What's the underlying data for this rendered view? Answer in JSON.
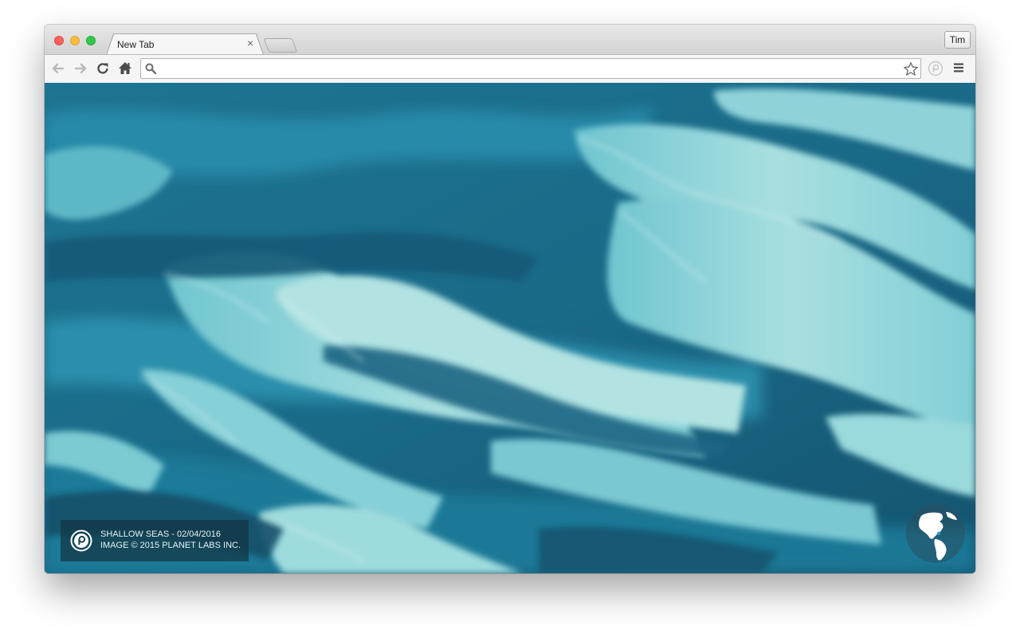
{
  "browser": {
    "tab": {
      "title": "New Tab",
      "close_glyph": "×"
    },
    "profile_name": "Tim",
    "omnibox": {
      "value": "",
      "placeholder": ""
    },
    "icons": {
      "back": "back-arrow-icon",
      "forward": "forward-arrow-icon",
      "reload": "reload-icon",
      "home": "home-icon",
      "search": "search-icon",
      "bookmark": "star-icon",
      "extension": "planet-extension-icon",
      "menu": "hamburger-menu-icon"
    }
  },
  "page": {
    "caption": {
      "line1": "SHALLOW SEAS - 02/04/2016",
      "line2": "IMAGE © 2015 PLANET LABS INC."
    }
  },
  "colors": {
    "water_dark": "#14526e",
    "water_mid": "#2a8aa8",
    "sand_light": "#a8e0e2",
    "window_traffic_close": "#fc605c",
    "window_traffic_min": "#fdbc40",
    "window_traffic_max": "#34c84a"
  }
}
